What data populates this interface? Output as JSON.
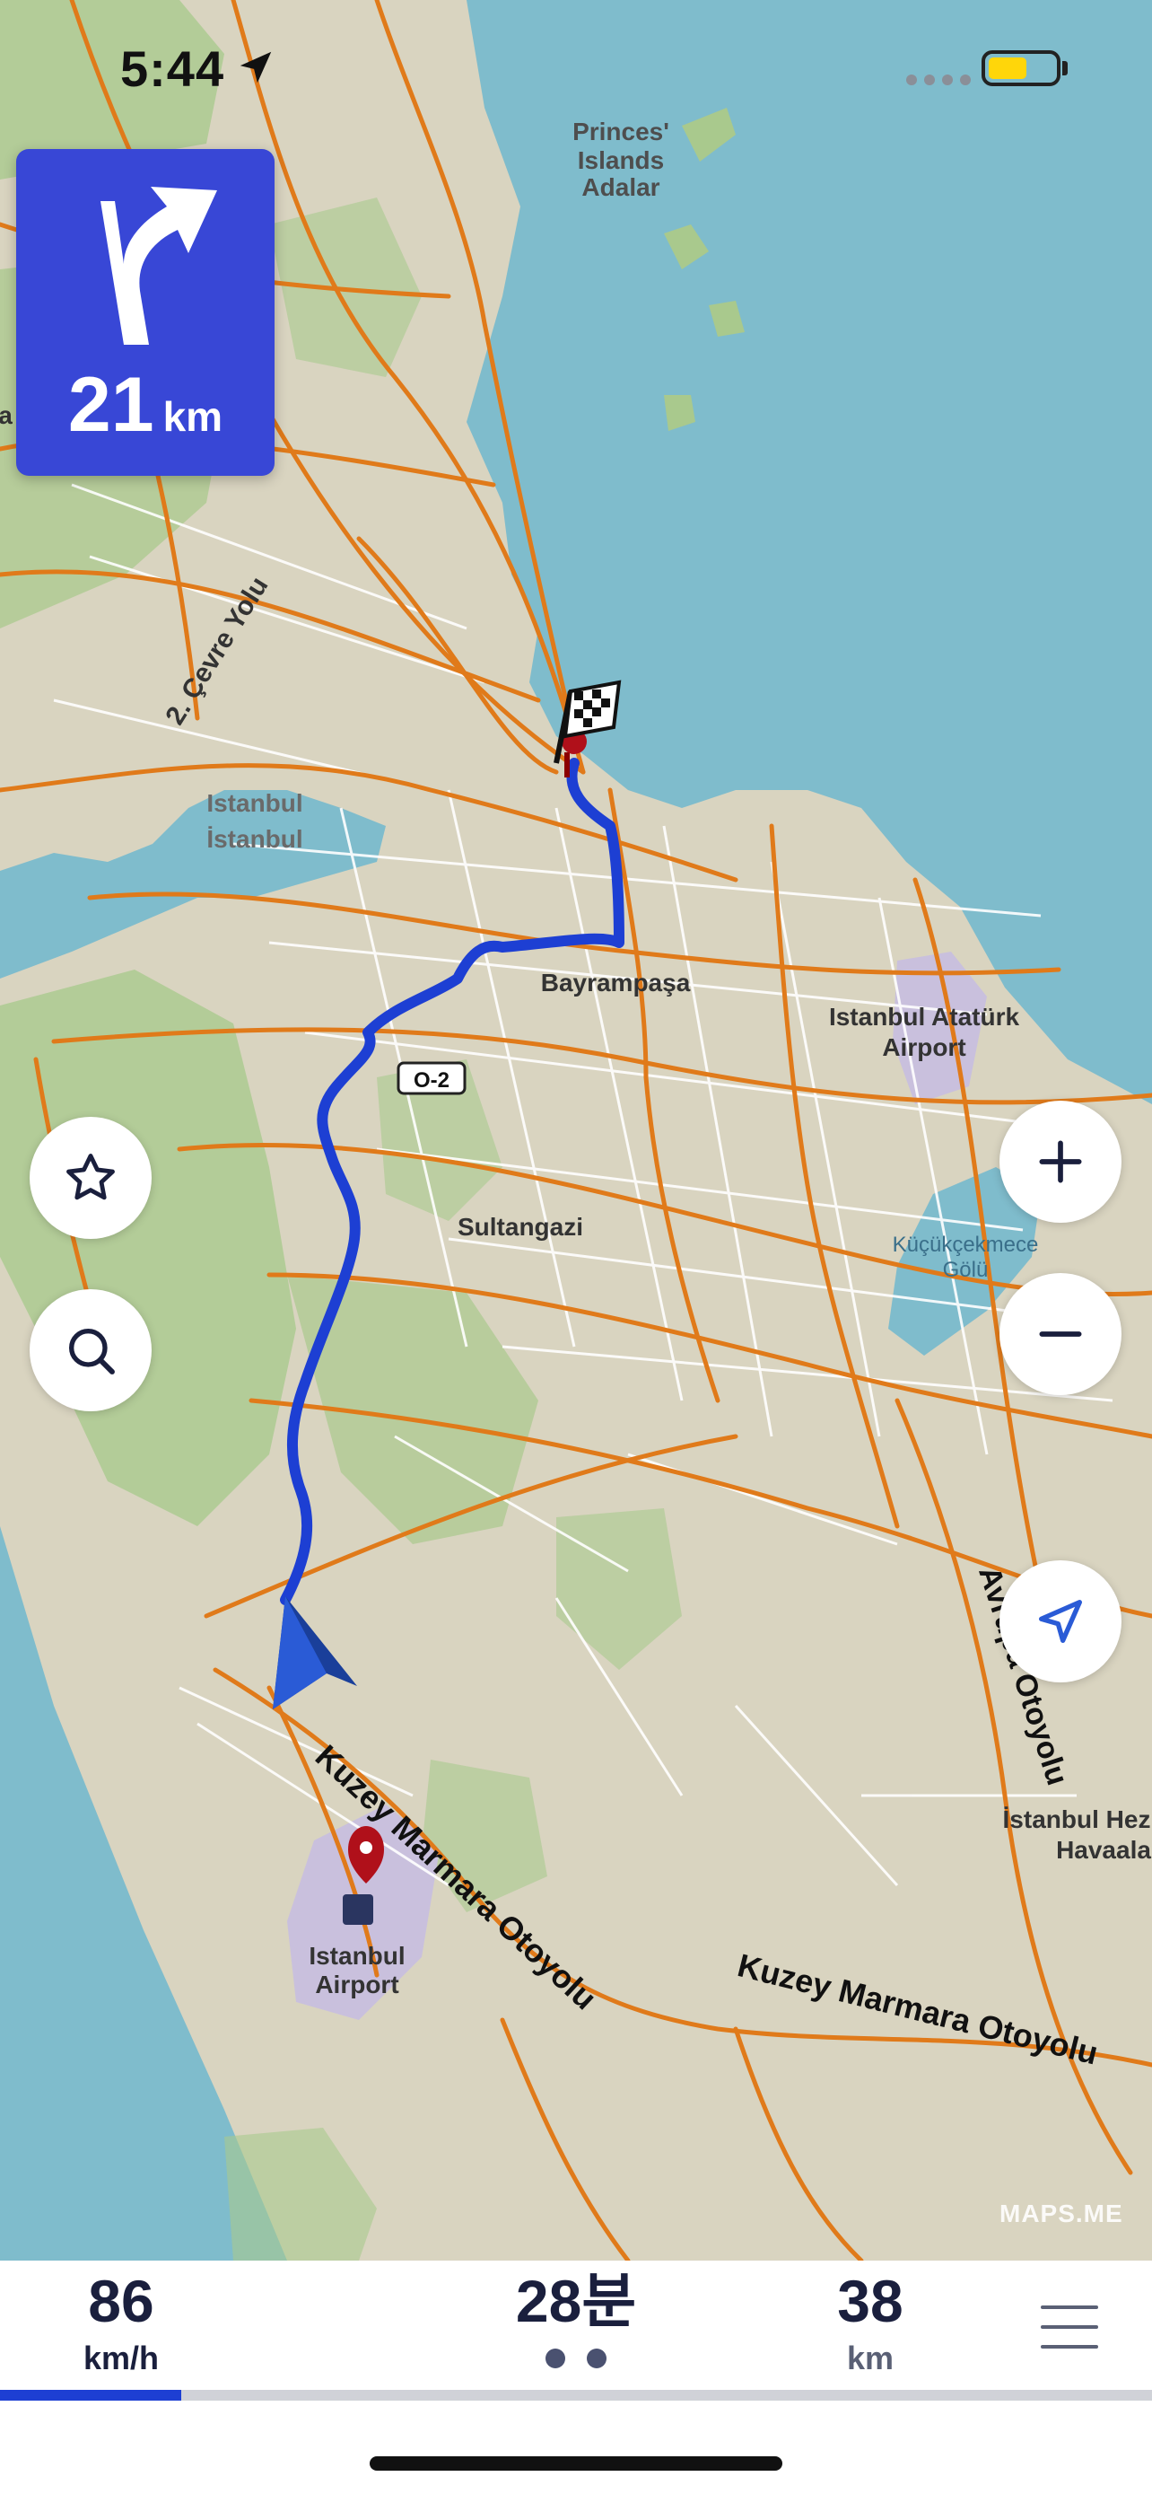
{
  "status_bar": {
    "time": "5:44",
    "location_icon": "location-arrow-icon",
    "battery_color": "#ffd60a"
  },
  "turn_instruction": {
    "icon": "turn-right-icon",
    "distance_value": "21",
    "distance_unit": "km",
    "color": "#3847d6"
  },
  "map": {
    "labels": {
      "princes_line1": "Princes'",
      "princes_line2": "Islands",
      "princes_line3": "Adalar",
      "cevre_yolu": "2. Çevre Yolu",
      "istanbul_1": "Istanbul",
      "istanbul_2": "İstanbul",
      "bayrampasa": "Bayrampaşa",
      "ataturk_1": "Istanbul Atatürk",
      "ataturk_2": "Airport",
      "o2": "O-2",
      "sultangazi": "Sultangazi",
      "kucukcekmece_1": "Küçükçekmece",
      "kucukcekmece_2": "Gölü",
      "avrupa": "Avrupa Otoyolu",
      "kuzey_1": "Kuzey Marmara Otoyolu",
      "kuzey_2": "Kuzey Marmara Otoyolu",
      "airport_1": "Istanbul",
      "airport_2": "Airport",
      "hez_1": "İstanbul Hez",
      "hez_2": "Havaala",
      "left_edge": "a"
    },
    "route_color": "#1d3fd3",
    "attribution": "MAPS.ME"
  },
  "controls": {
    "favorites": "star-icon",
    "search": "search-icon",
    "zoom_in": "plus-icon",
    "zoom_out": "minus-icon",
    "my_location": "navigation-arrow-icon"
  },
  "bottom_bar": {
    "speed_value": "86",
    "speed_unit": "km/h",
    "time_value": "28분",
    "distance_value": "38",
    "distance_unit": "km",
    "progress_percent": 15.7,
    "menu_icon": "hamburger-menu-icon"
  }
}
